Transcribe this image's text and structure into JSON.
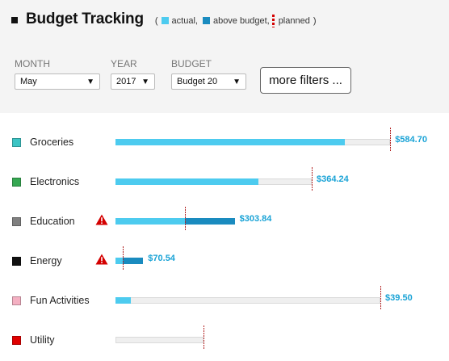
{
  "header": {
    "title": "Budget Tracking",
    "legend": {
      "open_paren": "(",
      "actual_label": "actual,",
      "above_label": "above budget,",
      "planned_label": "planned",
      "close_paren": ")"
    }
  },
  "filters": {
    "month": {
      "label": "MONTH",
      "value": "May"
    },
    "year": {
      "label": "YEAR",
      "value": "2017"
    },
    "budget": {
      "label": "BUDGET",
      "value": "Budget 20"
    },
    "more_label": "more filters ..."
  },
  "colors": {
    "actual": "#4dcbef",
    "above_budget": "#1a8bbf",
    "planned": "#c00000",
    "amount_text": "#1aa3d6"
  },
  "categories": [
    {
      "name": "Groceries",
      "color": "#3cc4c4",
      "amount": "$584.70",
      "warning": false,
      "actual": 584.7,
      "planned": 700
    },
    {
      "name": "Electronics",
      "color": "#36a852",
      "amount": "$364.24",
      "warning": false,
      "actual": 364.24,
      "planned": 500
    },
    {
      "name": "Education",
      "color": "#808080",
      "amount": "$303.84",
      "warning": true,
      "actual": 303.84,
      "planned": 176
    },
    {
      "name": "Energy",
      "color": "#111111",
      "amount": "$70.54",
      "warning": true,
      "actual": 70.54,
      "planned": 19
    },
    {
      "name": "Fun Activities",
      "color": "#f4b0c2",
      "amount": "$39.50",
      "warning": false,
      "actual": 39.5,
      "planned": 675
    },
    {
      "name": "Utility",
      "color": "#e00000",
      "amount": "",
      "warning": false,
      "actual": 0,
      "planned": 225
    }
  ],
  "scale_max": 900
}
